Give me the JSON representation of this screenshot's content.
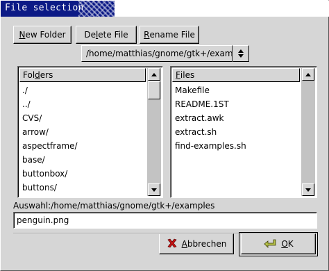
{
  "window": {
    "title": "File selection"
  },
  "toolbar": {
    "new_folder": {
      "mnemonic": "N",
      "rest": "ew Folder"
    },
    "delete_file": {
      "pre": "De",
      "mnemonic": "l",
      "rest": "ete File"
    },
    "rename_file": {
      "mnemonic": "R",
      "rest": "ename File"
    }
  },
  "path": {
    "current": "/home/matthias/gnome/gtk+/examples"
  },
  "folders": {
    "header": {
      "pre": "Fol",
      "mnemonic": "d",
      "rest": "ers"
    },
    "items": [
      "./",
      "../",
      "CVS/",
      "arrow/",
      "aspectframe/",
      "base/",
      "buttonbox/",
      "buttons/"
    ]
  },
  "files": {
    "header": {
      "mnemonic": "F",
      "rest": "iles"
    },
    "items": [
      "Makefile",
      "README.1ST",
      "extract.awk",
      "extract.sh",
      "find-examples.sh"
    ]
  },
  "selection": {
    "label": "Auswahl:/home/matthias/gnome/gtk+/examples",
    "value": "penguin.png"
  },
  "actions": {
    "cancel": {
      "mnemonic": "A",
      "rest": "bbrechen",
      "icon": "cross-icon"
    },
    "ok": {
      "mnemonic": "O",
      "rest": "K",
      "icon": "check-icon"
    }
  },
  "colors": {
    "titlebar": "#0c1a86",
    "background": "#d6d6d6"
  }
}
